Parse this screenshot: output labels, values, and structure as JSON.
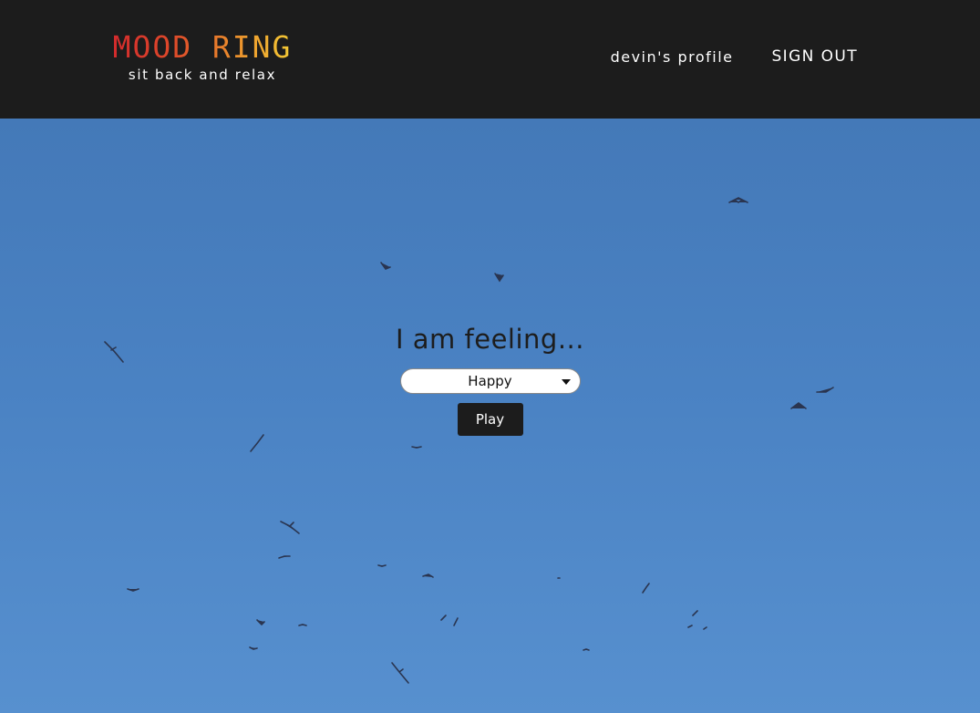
{
  "header": {
    "logo_text": "MOOD RING",
    "tagline": "sit back and relax",
    "nav": {
      "profile_label": "devin's profile",
      "signout_label": "SIGN OUT"
    }
  },
  "main": {
    "prompt": "I am feeling...",
    "mood_select": {
      "selected": "Happy"
    },
    "play_label": "Play",
    "background_image": "sky-with-birds"
  },
  "colors": {
    "header_bg": "#1c1c1c",
    "sky": "#4a82c3",
    "logo_gradient": [
      "#d2282d",
      "#ea8a2c",
      "#f4cf35"
    ]
  }
}
